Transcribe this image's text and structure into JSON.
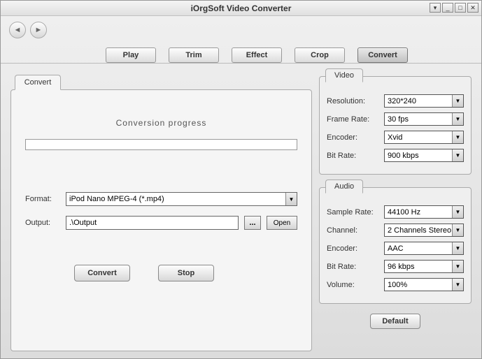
{
  "title": "iOrgSoft Video Converter",
  "tabs": {
    "play": "Play",
    "trim": "Trim",
    "effect": "Effect",
    "crop": "Crop",
    "convert": "Convert"
  },
  "left": {
    "subtab": "Convert",
    "progress_title": "Conversion  progress",
    "format_label": "Format:",
    "format_value": "iPod Nano MPEG-4 (*.mp4)",
    "output_label": "Output:",
    "output_value": ".\\Output",
    "browse_label": "...",
    "open_label": "Open",
    "convert_btn": "Convert",
    "stop_btn": "Stop"
  },
  "video": {
    "title": "Video",
    "resolution_label": "Resolution:",
    "resolution_value": "320*240",
    "framerate_label": "Frame Rate:",
    "framerate_value": "30 fps",
    "encoder_label": "Encoder:",
    "encoder_value": "Xvid",
    "bitrate_label": "Bit Rate:",
    "bitrate_value": "900 kbps"
  },
  "audio": {
    "title": "Audio",
    "samplerate_label": "Sample Rate:",
    "samplerate_value": "44100 Hz",
    "channel_label": "Channel:",
    "channel_value": "2 Channels Stereo",
    "encoder_label": "Encoder:",
    "encoder_value": "AAC",
    "bitrate_label": "Bit Rate:",
    "bitrate_value": "96 kbps",
    "volume_label": "Volume:",
    "volume_value": "100%"
  },
  "default_btn": "Default"
}
